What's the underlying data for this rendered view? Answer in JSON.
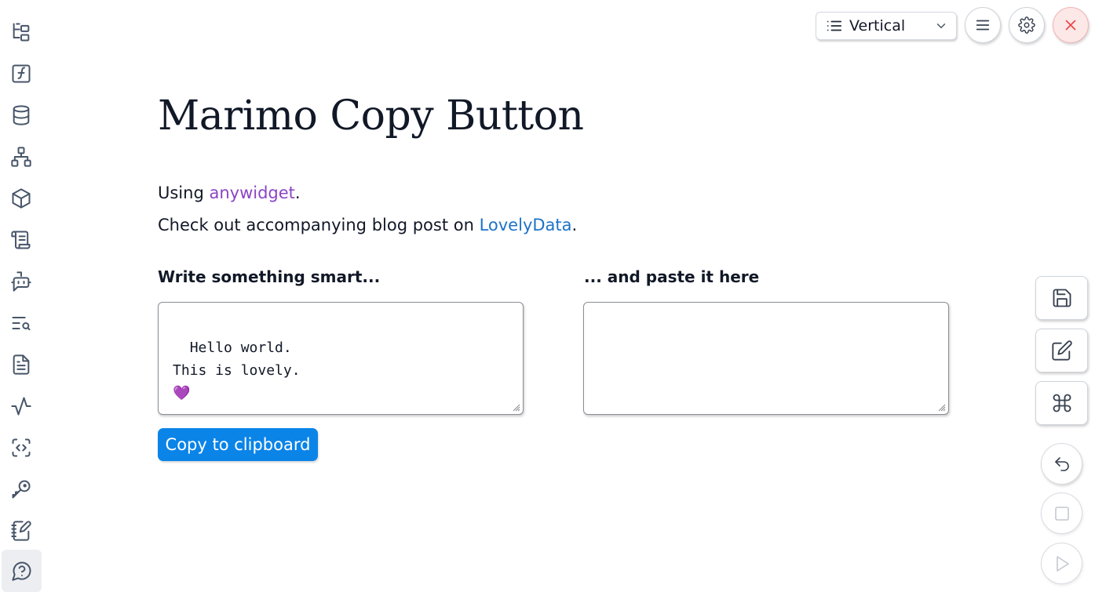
{
  "header": {
    "layout_label": "Vertical"
  },
  "main": {
    "title": "Marimo Copy Button",
    "using_prefix": "Using ",
    "using_link": "anywidget",
    "using_suffix": ".",
    "blog_prefix": "Check out accompanying blog post on ",
    "blog_link": "LovelyData",
    "blog_suffix": ".",
    "left_label": "Write something smart...",
    "right_label": "... and paste it here",
    "left_text": "Hello world.\nThis is lovely.\n💜",
    "right_text": "",
    "copy_button_label": "Copy to clipboard"
  },
  "sidebar": {
    "icons": [
      "file-tree-icon",
      "function-icon",
      "database-icon",
      "dependency-graph-icon",
      "package-icon",
      "scroll-icon",
      "bot-icon",
      "search-list-icon",
      "document-icon",
      "activity-icon",
      "code-snippet-icon",
      "key-icon",
      "notebook-pen-icon",
      "help-icon"
    ]
  },
  "colors": {
    "accent_button": "#0b84e8",
    "link_purple": "#8b45c4",
    "link_blue": "#1d73c9",
    "close_button": "#ef4444"
  }
}
